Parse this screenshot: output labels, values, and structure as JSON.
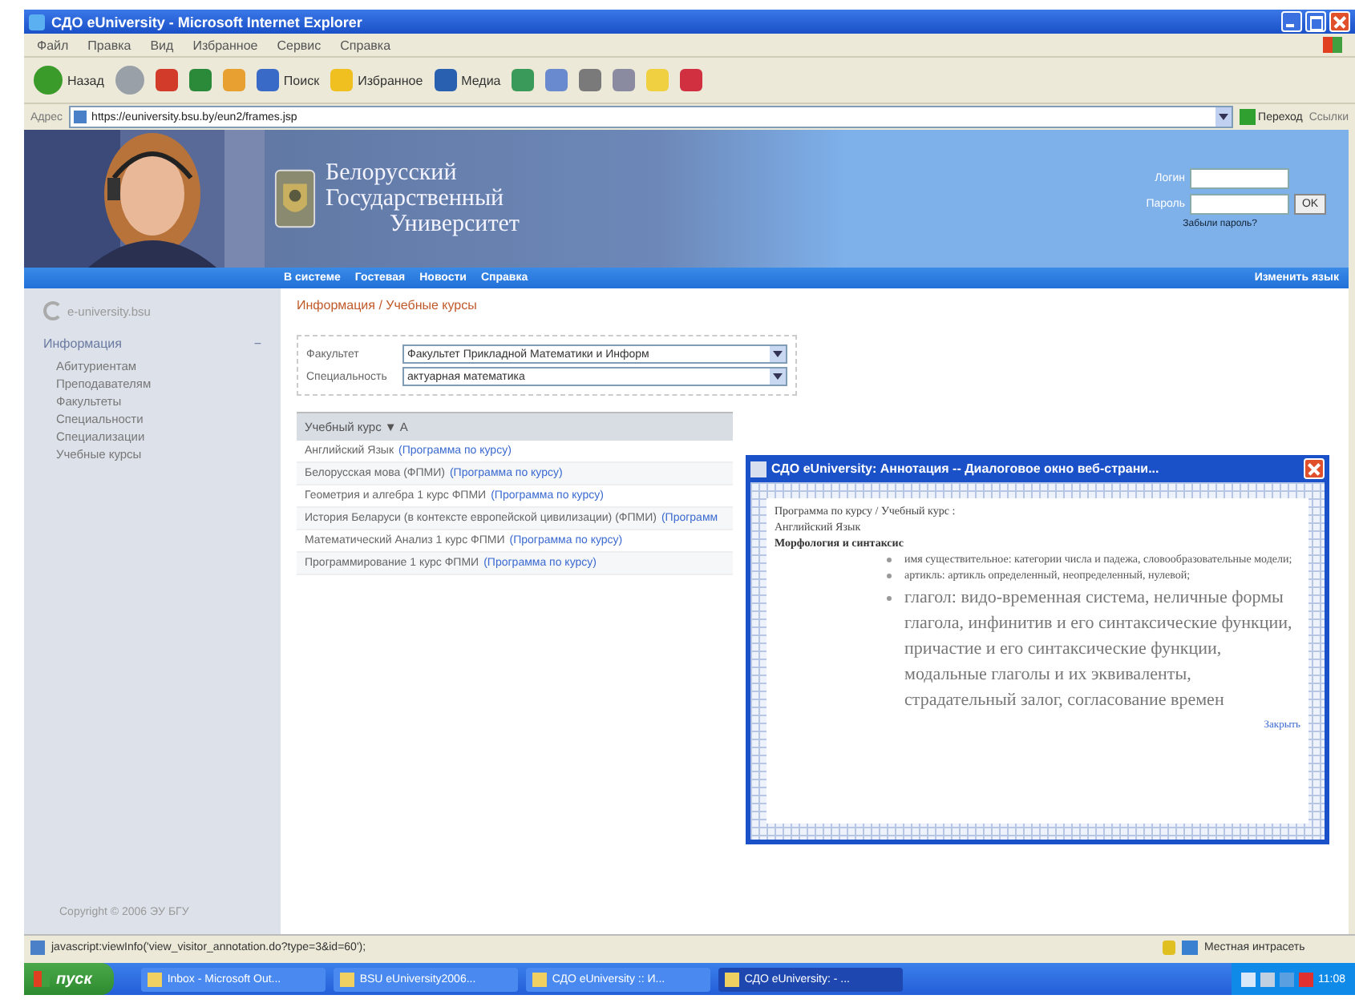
{
  "window": {
    "title": "СДО eUniversity - Microsoft Internet Explorer"
  },
  "menu": [
    "Файл",
    "Правка",
    "Вид",
    "Избранное",
    "Сервис",
    "Справка"
  ],
  "toolbar": [
    {
      "kind": "back",
      "label": "Назад"
    },
    {
      "kind": "forward"
    },
    {
      "kind": "stop"
    },
    {
      "kind": "refresh"
    },
    {
      "kind": "home"
    },
    {
      "kind": "search",
      "label": "Поиск"
    },
    {
      "kind": "favorites",
      "label": "Избранное"
    },
    {
      "kind": "media",
      "label": "Медиа"
    },
    {
      "kind": "history"
    },
    {
      "kind": "mail"
    },
    {
      "kind": "print"
    },
    {
      "kind": "edit"
    },
    {
      "kind": "folder"
    },
    {
      "kind": "messenger"
    }
  ],
  "address": {
    "label": "Адрес",
    "url": "https://euniversity.bsu.by/eun2/frames.jsp",
    "go": "Переход",
    "links": "Ссылки"
  },
  "site": {
    "title_lines": [
      "Белорусский",
      "Государственный",
      "Университет"
    ],
    "login_label": "Логин",
    "password_label": "Пароль",
    "ok": "OK",
    "forgot": "Забыли пароль?"
  },
  "nav": {
    "items": [
      "В системе",
      "Гостевая",
      "Новости",
      "Справка"
    ],
    "language": "Изменить язык"
  },
  "sidebar": {
    "logo": "e-university.bsu",
    "section": "Информация",
    "toggle": "−",
    "items": [
      "Абитуриентам",
      "Преподавателям",
      "Факультеты",
      "Специальности",
      "Специализации",
      "Учебные курсы"
    ],
    "copyright": "Copyright © 2006 ЭУ БГУ"
  },
  "breadcrumb": "Информация / Учебные курсы",
  "filters": [
    {
      "label": "Факультет",
      "value": "Факультет Прикладной Математики и Информ"
    },
    {
      "label": "Специальность",
      "value": "актуарная математика"
    }
  ],
  "courses": {
    "header": "Учебный курс",
    "sort": "▼ А",
    "rows": [
      {
        "name": "Английский Язык",
        "link": "(Программа по курсу)"
      },
      {
        "name": "Белорусская мова (ФПМИ)",
        "link": "(Программа по курсу)"
      },
      {
        "name": "Геометрия и алгебра 1 курс ФПМИ",
        "link": "(Программа по курсу)"
      },
      {
        "name": "История Беларуси (в контексте европейской цивилизации) (ФПМИ)",
        "link": "(Программ"
      },
      {
        "name": "Математический Анализ 1 курс ФПМИ",
        "link": "(Программа по курсу)"
      },
      {
        "name": "Программирование 1 курс ФПМИ",
        "link": "(Программа по курсу)"
      }
    ]
  },
  "dialog": {
    "title": "СДО eUniversity: Аннотация -- Диалоговое окно веб-страни...",
    "path": "Программа по курсу / Учебный курс :",
    "course": "Английский Язык",
    "section": "Морфология и синтаксис",
    "bullets": [
      {
        "kind": "small",
        "text": "имя существительное: категории числа и падежа, словообразовательные модели;"
      },
      {
        "kind": "small",
        "text": "артикль: артикль определенный, неопределенный, нулевой;"
      },
      {
        "kind": "large",
        "text": "глагол: видо-временная система, неличные формы глагола, инфинитив и его синтаксические функции, причастие и его синтаксические функции, модальные глаголы и их эквиваленты, страдательный залог, согласование времен"
      }
    ],
    "close": "Закрыть"
  },
  "status_bar": {
    "text": "javascript:viewInfo('view_visitor_annotation.do?type=3&id=60');",
    "zone": "Местная интрасеть"
  },
  "taskbar": {
    "start": "пуск",
    "tasks": [
      {
        "label": "Inbox - Microsoft Out...",
        "selected": false
      },
      {
        "label": "BSU eUniversity2006...",
        "selected": false
      },
      {
        "label": "СДО eUniversity :: И...",
        "selected": false
      },
      {
        "label": "СДО eUniversity: - ...",
        "selected": true
      }
    ],
    "clock": "11:08"
  }
}
